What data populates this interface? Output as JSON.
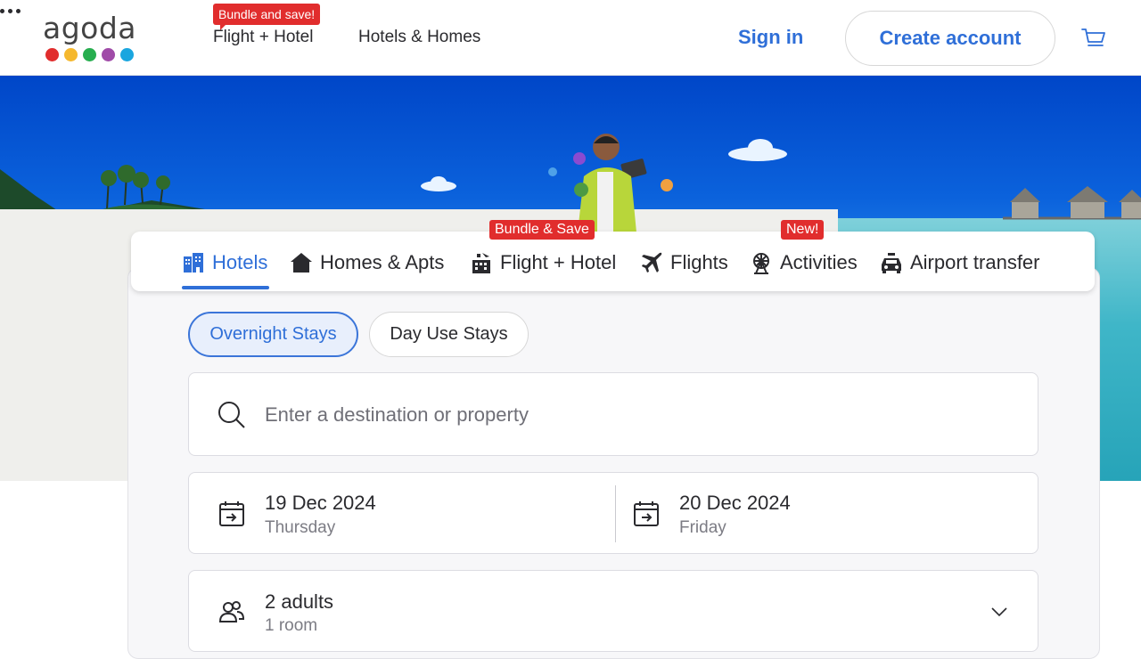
{
  "header": {
    "logo_text": "agoda",
    "logo_dot_colors": [
      "#e12d2d",
      "#f5b82e",
      "#27ae4f",
      "#a04ba8",
      "#1aa6df"
    ],
    "nav": {
      "flight_badge": "Bundle and save!",
      "flight_label": "Flight + Hotel",
      "homes_label": "Hotels & Homes"
    },
    "sign_in": "Sign in",
    "create_account": "Create account"
  },
  "tabs": {
    "items": [
      {
        "label": "Hotels",
        "icon": "hotel-building-icon",
        "active": true
      },
      {
        "label": "Homes & Apts",
        "icon": "house-icon"
      },
      {
        "label": "Flight + Hotel",
        "icon": "flight-hotel-icon",
        "badge": "Bundle & Save"
      },
      {
        "label": "Flights",
        "icon": "airplane-icon"
      },
      {
        "label": "Activities",
        "icon": "ferris-wheel-icon",
        "badge": "New!"
      },
      {
        "label": "Airport transfer",
        "icon": "car-icon"
      }
    ]
  },
  "stay_type": {
    "overnight": "Overnight Stays",
    "day_use": "Day Use Stays",
    "selected": "Overnight Stays"
  },
  "search": {
    "placeholder": "Enter a destination or property",
    "value": ""
  },
  "dates": {
    "check_in": {
      "date": "19 Dec 2024",
      "day": "Thursday"
    },
    "check_out": {
      "date": "20 Dec 2024",
      "day": "Friday"
    }
  },
  "guests": {
    "main": "2 adults",
    "sub": "1 room"
  },
  "colors": {
    "accent": "#2f6fd8",
    "badge": "#e12d2d"
  }
}
